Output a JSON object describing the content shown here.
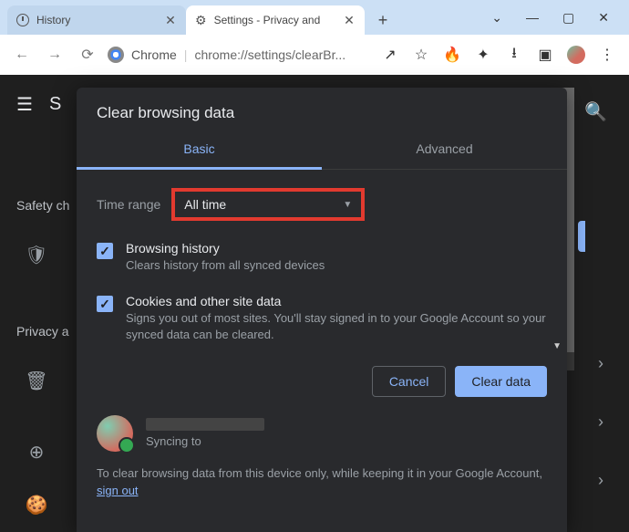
{
  "window": {
    "tabs": [
      {
        "title": "History"
      },
      {
        "title": "Settings - Privacy and"
      }
    ],
    "controls": {
      "chevron": "⌄",
      "min": "—",
      "max": "▢",
      "close": "✕"
    }
  },
  "toolbar": {
    "chrome_label": "Chrome",
    "url": "chrome://settings/clearBr...",
    "icons": {
      "share": "↗",
      "star": "☆",
      "fire": "🔥",
      "puzzle": "✦",
      "download": "⭳",
      "panel": "▣",
      "menu": "⋮"
    }
  },
  "background": {
    "s_label": "S",
    "safety": "Safety ch",
    "privacy": "Privacy a"
  },
  "dialog": {
    "title": "Clear browsing data",
    "tabs": {
      "basic": "Basic",
      "advanced": "Advanced"
    },
    "time_range_label": "Time range",
    "time_range_value": "All time",
    "options": [
      {
        "title": "Browsing history",
        "desc": "Clears history from all synced devices",
        "checked": true
      },
      {
        "title": "Cookies and other site data",
        "desc": "Signs you out of most sites. You'll stay signed in to your Google Account so your synced data can be cleared.",
        "checked": true
      }
    ],
    "buttons": {
      "cancel": "Cancel",
      "clear": "Clear data"
    },
    "sync_label": "Syncing to",
    "note_prefix": "To clear browsing data from this device only, while keeping it in your Google Account, ",
    "note_link": "sign out"
  }
}
